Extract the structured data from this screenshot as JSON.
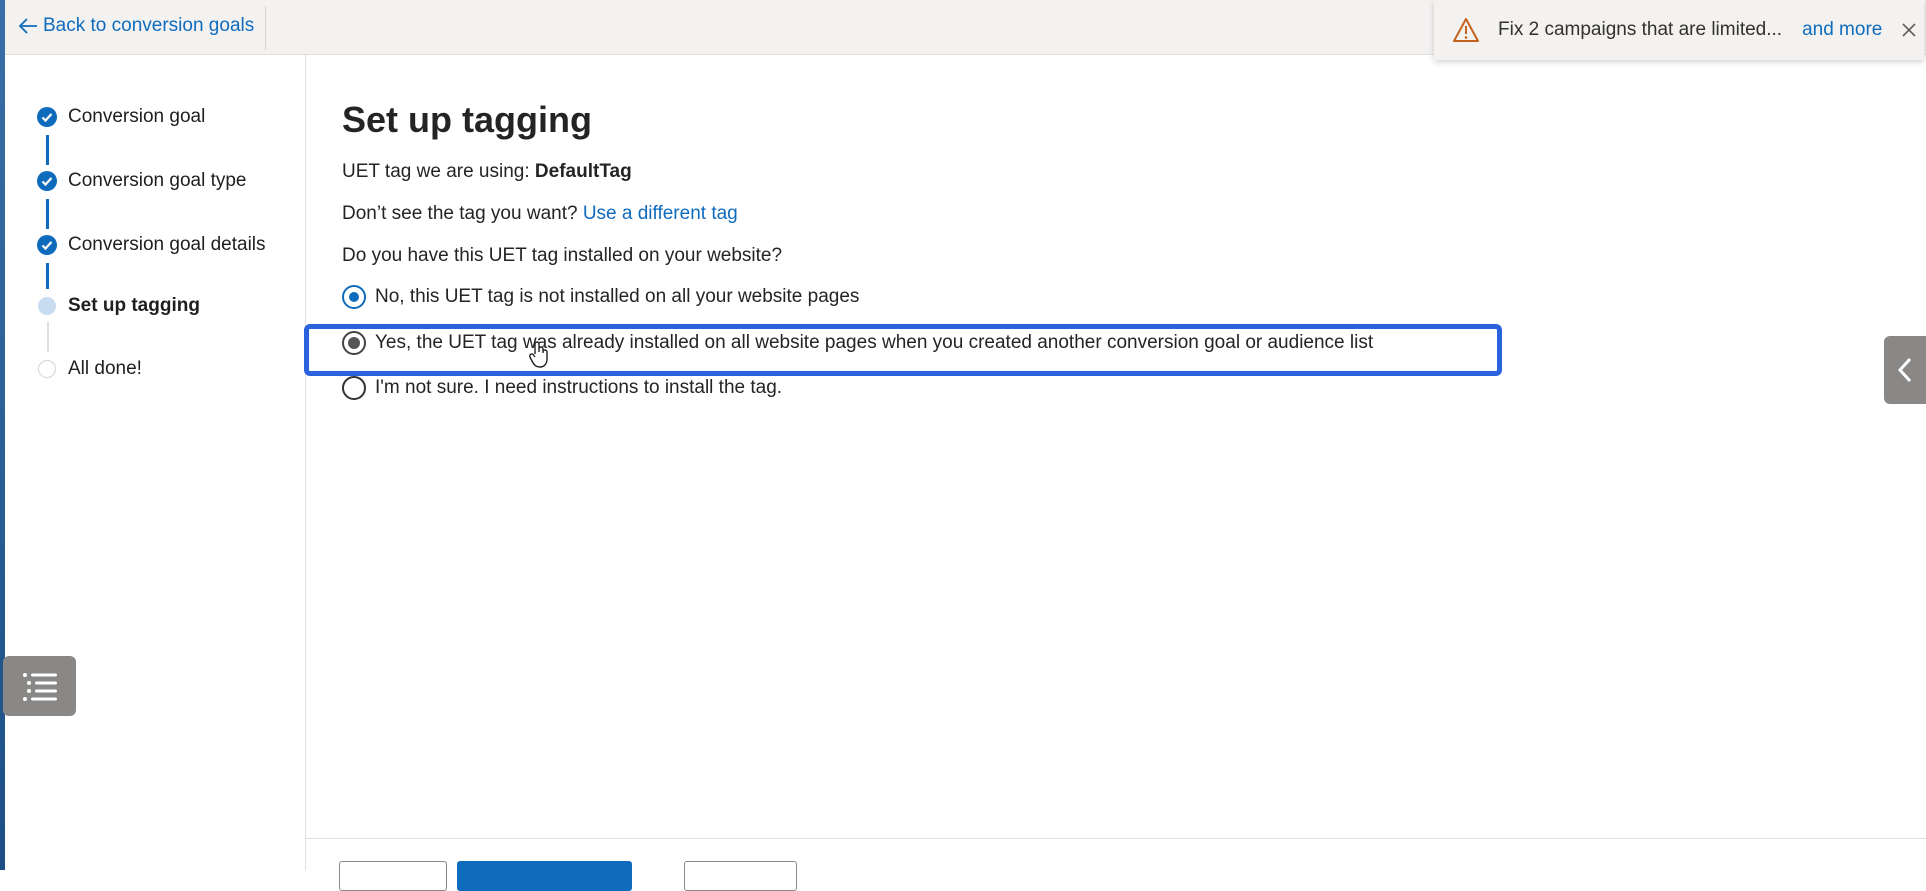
{
  "topbar": {
    "back_label": "Back to conversion goals"
  },
  "notification": {
    "message": "Fix 2 campaigns that are limited...",
    "more_label": "and more",
    "icon": "warning-icon",
    "warning_color": "#c4621f"
  },
  "wizard": {
    "steps": [
      {
        "label": "Conversion goal",
        "status": "done"
      },
      {
        "label": "Conversion goal type",
        "status": "done"
      },
      {
        "label": "Conversion goal details",
        "status": "done"
      },
      {
        "label": "Set up tagging",
        "status": "current"
      },
      {
        "label": "All done!",
        "status": "todo"
      }
    ]
  },
  "main": {
    "title": "Set up tagging",
    "tag_using_label": "UET tag we are using:",
    "tag_name": "DefaultTag",
    "dont_see_label": "Don’t see the tag you want?",
    "different_tag_link": "Use a different tag",
    "question": "Do you have this UET tag installed on your website?",
    "options": [
      {
        "label": "No, this UET tag is not installed on all your website pages",
        "state": "selected"
      },
      {
        "label": "Yes, the UET tag was already installed on all website pages when you created another conversion goal or audience list",
        "state": "pressed"
      },
      {
        "label": "I'm not sure. I need instructions to install the tag.",
        "state": "unselected"
      }
    ]
  },
  "colors": {
    "accent": "#0f6cbd",
    "highlight": "#2b63de"
  }
}
